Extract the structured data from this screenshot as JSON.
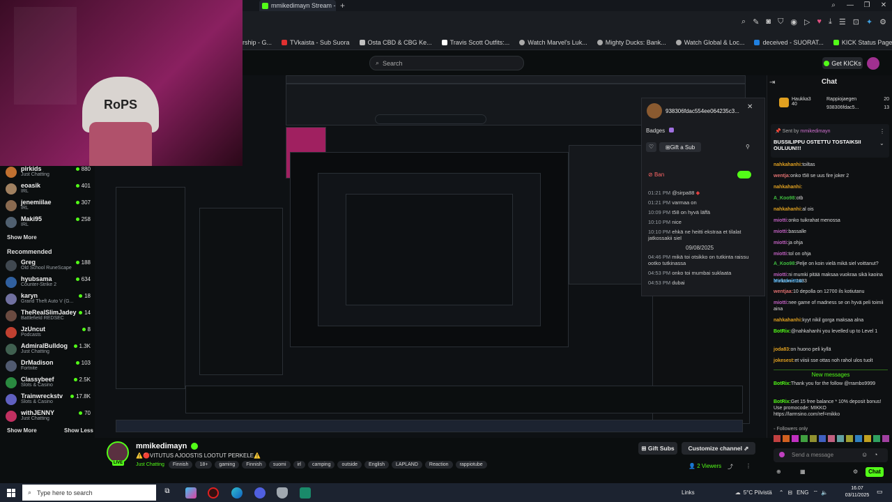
{
  "browser": {
    "tab_title": "mmikedimayn Stream - ",
    "new_tab": "+",
    "bookmarks": [
      "rship - G...",
      "TVkaista - Sub Suora",
      "Osta CBD & CBG Ke...",
      "Travis Scott Outfits:...",
      "Watch Marvel's Luk...",
      "Mighty Ducks: Bank...",
      "Watch Global & Loc...",
      "deceived - SUORAT...",
      "KICK Status Page"
    ]
  },
  "header": {
    "search_placeholder": "Search",
    "get_kicks": "Get KICKs"
  },
  "webcam": {
    "beanie_text": "RoPS"
  },
  "sidebar": {
    "followed": [
      {
        "name": "pirkids",
        "category": "Just Chatting",
        "viewers": "880",
        "color": "#c07030"
      },
      {
        "name": "eoasik",
        "category": "IRL",
        "viewers": "401",
        "color": "#a08060"
      },
      {
        "name": "jenemiilae",
        "category": "IRL",
        "viewers": "307",
        "color": "#8a6a50"
      },
      {
        "name": "Maki95",
        "category": "IRL",
        "viewers": "258",
        "color": "#506070"
      }
    ],
    "show_more": "Show More",
    "recommended_heading": "Recommended",
    "recommended": [
      {
        "name": "Greg",
        "category": "Old School RuneScape",
        "viewers": "188",
        "color": "#404850"
      },
      {
        "name": "hyubsama",
        "category": "Counter-Strike 2",
        "viewers": "634",
        "color": "#3060a0"
      },
      {
        "name": "karyn",
        "category": "Grand Theft Auto V (G...",
        "viewers": "18",
        "color": "#7070a0"
      },
      {
        "name": "TheRealSlimJadey",
        "category": "Battlefield REDSEC",
        "viewers": "14",
        "color": "#6a4a40"
      },
      {
        "name": "JzUncut",
        "category": "Podcasts",
        "viewers": "8",
        "color": "#c04030"
      },
      {
        "name": "AdmiralBulldog",
        "category": "Just Chatting",
        "viewers": "1.3K",
        "color": "#406050"
      },
      {
        "name": "DrMadison",
        "category": "Fortnite",
        "viewers": "103",
        "color": "#505a70"
      },
      {
        "name": "Classybeef",
        "category": "Slots & Casino",
        "viewers": "2.5K",
        "color": "#2a8a40"
      },
      {
        "name": "Trainwreckstv",
        "category": "Slots & Casino",
        "viewers": "17.8K",
        "color": "#6060c0"
      },
      {
        "name": "withJENNY",
        "category": "Just Chatting",
        "viewers": "70",
        "color": "#c03060"
      }
    ],
    "show_more_2": "Show More",
    "show_less": "Show Less"
  },
  "usercard": {
    "username": "938306fdac554ee064235c3...",
    "badges_label": "Badges",
    "gift_sub": "Gift a Sub",
    "ban_label": "Ban",
    "messages": [
      {
        "time": "01:21 PM",
        "text": "@sirpa88"
      },
      {
        "time": "01:21 PM",
        "text": "varmaa on"
      },
      {
        "time": "10:09 PM",
        "text": "t58 on hyvä läffä"
      },
      {
        "time": "10:10 PM",
        "text": "nice"
      },
      {
        "time": "10:10 PM",
        "text": "ehkä ne heitti ekstraa et tilalat jatkossakii siel"
      }
    ],
    "date_divider": "09/08/2025",
    "messages2": [
      {
        "time": "04:46 PM",
        "text": "mikä toi otsikko on tutkinta raissu ootko tutkinassa"
      },
      {
        "time": "04:53 PM",
        "text": "onko toi mumbai suklaata"
      },
      {
        "time": "04:53 PM",
        "text": "dubai"
      }
    ]
  },
  "chat": {
    "title": "Chat",
    "top_gifter_1": "Haukka3",
    "top_gifter_1_count": "40",
    "top_gifter_2": "Rappiojaegen",
    "top_gifter_2_count": "20",
    "top_gifter_3": "938306fdac5...",
    "top_gifter_3_count": "13",
    "pinned_label": "Sent by",
    "pinned_user": "mmikedimayn",
    "pinned_text": "BUSSILIPPU OSTETTU TOSTAIKSII OULUUN!!!",
    "messages": [
      {
        "user": "nahkahanhi:",
        "text": "toiltas",
        "color": "#e0a020"
      },
      {
        "user": "wentja:",
        "text": "onko t58 se uus fire joker 2",
        "color": "#e07070"
      },
      {
        "user": "nahkahanhi:",
        "text": "",
        "color": "#e0a020"
      },
      {
        "user": "A_Koo98:",
        "text": "otb",
        "color": "#40c040"
      },
      {
        "user": "nahkahanhi:",
        "text": "al ois",
        "color": "#e0a020"
      },
      {
        "user": "miotti:",
        "text": "onko tuikrahat menossa",
        "color": "#c060c0"
      },
      {
        "user": "miotti:",
        "text": "bassalle",
        "color": "#c060c0"
      },
      {
        "user": "miotti:",
        "text": "ja ohja",
        "color": "#c060c0"
      },
      {
        "user": "miotti:",
        "text": "tol on ohja",
        "color": "#c060c0"
      },
      {
        "user": "A_Koo98:",
        "text": "Pelje on koin vielä mikä siel voittanut?",
        "color": "#40c040"
      },
      {
        "user": "miotti:",
        "text": "ni mumki pitää maksaa vuokraa sikä kaoina brinktonie 1833",
        "color": "#c060c0"
      },
      {
        "user": "Mohukeittoo:",
        "text": "",
        "color": "#40a0e0"
      },
      {
        "user": "wentjaa:",
        "text": "10 depolla on 12700 ils kotiutanu",
        "color": "#e07070"
      },
      {
        "user": "miotti:",
        "text": "nee game of madness se on hyvä peli toimii aina",
        "color": "#c060c0"
      },
      {
        "user": "nahkahanhi:",
        "text": "kyyt nikil gorga maksaa alna",
        "color": "#e0a020"
      },
      {
        "user": "BotRix:",
        "text": "@nahkahanhi you levelled up to Level 1",
        "color": "#53fc18"
      },
      {
        "user": "joda83:",
        "text": "on huono peli kyllä",
        "color": "#e0a020"
      },
      {
        "user": "jokesest:",
        "text": "et viisii sse ottas noh rahol ulos tuolt",
        "color": "#e0a020"
      }
    ],
    "new_messages": "New messages",
    "messages_after": [
      {
        "user": "BotRix:",
        "text": "Thank you for the follow @rrambo9999",
        "color": "#53fc18"
      },
      {
        "user": "BotRix:",
        "text": "Get 15 free balance * 10% deposit bonus! Use promocode: MIKKO https://larmsino.com/ref=mikko",
        "color": "#53fc18"
      }
    ],
    "followers_only": "Followers only",
    "input_placeholder": "Send a message",
    "chat_button": "Chat"
  },
  "channel": {
    "name": "mmikedimayn",
    "live_badge": "LIVE",
    "title": "⚠️🔴VITUTUS AJOOSTIS LOOTUT PERKELE⚠️",
    "category": "Just Chatting",
    "tags": [
      "Finnish",
      "18+",
      "gaming",
      "Finnish",
      "suomi",
      "irl",
      "camping",
      "outside",
      "English",
      "LAPLAND",
      "Reaction",
      "rappiotube"
    ],
    "gift_subs": "Gift Subs",
    "customize": "Customize channel",
    "viewers": "2 Viewers"
  },
  "taskbar": {
    "search_placeholder": "Type here to search",
    "links": "Links",
    "weather": "5°C Pilvistä",
    "lang": "ENG",
    "time": "16.07",
    "date": "03/11/2025"
  },
  "colors": {
    "brand": "#53fc18",
    "bg": "#0b0e0f",
    "webcam": "#8a2060"
  }
}
